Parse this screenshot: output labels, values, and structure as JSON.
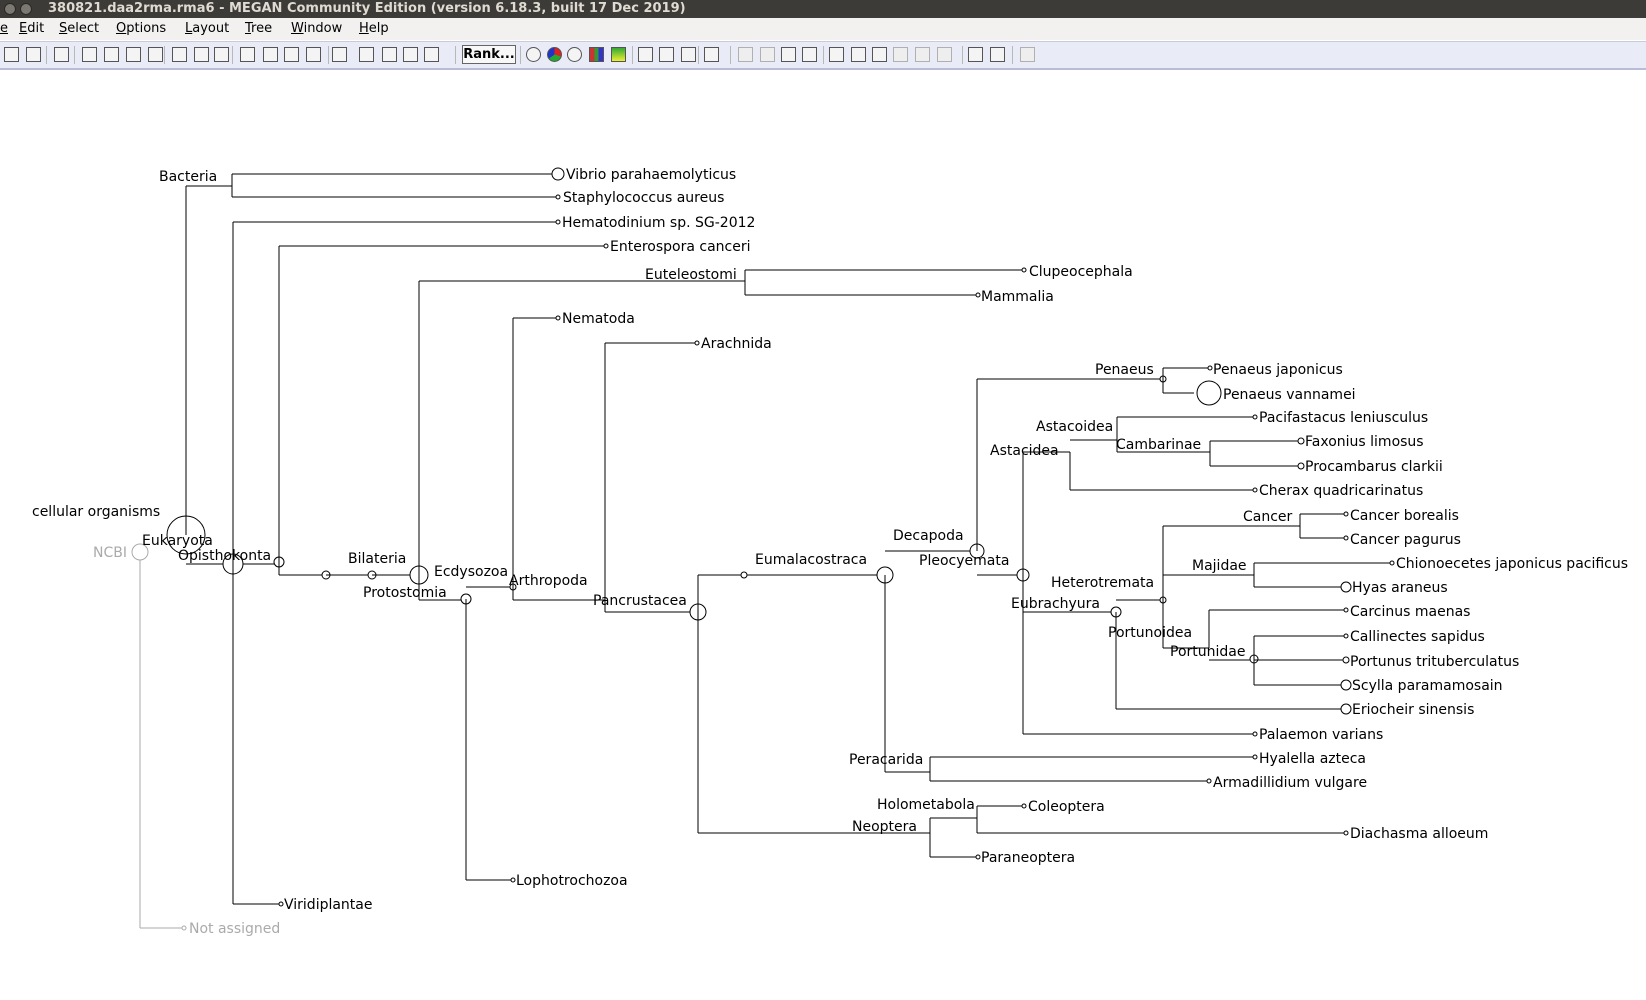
{
  "window": {
    "title": "380821.daa2rma.rma6 - MEGAN Community Edition (version 6.18.3, built 17 Dec 2019)"
  },
  "menu": [
    "e",
    "Edit",
    "Select",
    "Options",
    "Layout",
    "Tree",
    "Window",
    "Help"
  ],
  "toolbar": {
    "buttons": [
      "print-icon",
      "export-icon",
      "find-icon",
      "expand-vertical-icon",
      "contract-vertical-icon",
      "expand-horizontal-icon",
      "contract-horizontal-icon",
      "fit-tree-icon",
      "zoom-width-icon",
      "zoom-full-icon",
      "rooted-tree-icon",
      "cladogram-icon",
      "phylogram-icon",
      "radial-tree-icon",
      "heatmap-icon",
      "collapse-icon",
      "uncollapse-icon",
      "collapse-complement-icon",
      "keep-only-icon",
      "circle-node-icon",
      "pie-chart-icon",
      "coxcomb-icon",
      "bar-chart-icon",
      "heatmap-node-icon",
      "linear-scale-icon",
      "sqrt-scale-icon",
      "log-scale-icon",
      "chart-icon",
      "spacer-icon",
      "spacer-icon-2",
      "show-labels-icon",
      "color-icon",
      "taxon-names-icon",
      "taxon-ids-icon",
      "taxon-rank-icon",
      "assigned-icon",
      "summed-icon",
      "show-all-icon",
      "fit-icon",
      "table-icon",
      "details-icon"
    ],
    "rank_label": "Rank..."
  },
  "tree": {
    "labels": {
      "ncbi": "NCBI",
      "not_assigned": "Not assigned",
      "cellular": "cellular organisms",
      "bacteria": "Bacteria",
      "vibrio": "Vibrio parahaemolyticus",
      "staph": "Staphylococcus aureus",
      "eukaryota": "Eukaryota",
      "hematodinium": "Hematodinium sp. SG-2012",
      "opisthokonta": "Opisthokonta",
      "enterospora": "Enterospora canceri",
      "viridiplantae": "Viridiplantae",
      "bilateria": "Bilateria",
      "euteleostomi": "Euteleostomi",
      "clupeocephala": "Clupeocephala",
      "mammalia": "Mammalia",
      "protostomia": "Protostomia",
      "ecdysozoa": "Ecdysozoa",
      "nematoda": "Nematoda",
      "lophotrochozoa": "Lophotrochozoa",
      "arthropoda": "Arthropoda",
      "arachnida": "Arachnida",
      "pancrustacea": "Pancrustacea",
      "eumalacostraca": "Eumalacostraca",
      "decapoda": "Decapoda",
      "pleocyemata": "Pleocyemata",
      "penaeus": "Penaeus",
      "p_japonicus": "Penaeus japonicus",
      "p_vannamei": "Penaeus vannamei",
      "astacidea": "Astacidea",
      "astacoidea": "Astacoidea",
      "pacifastacus": "Pacifastacus leniusculus",
      "cambarinae": "Cambarinae",
      "faxonius": "Faxonius limosus",
      "procambarus": "Procambarus clarkii",
      "cherax": "Cherax quadricarinatus",
      "eubrachyura": "Eubrachyura",
      "heterotremata": "Heterotremata",
      "cancer": "Cancer",
      "c_borealis": "Cancer borealis",
      "c_pagurus": "Cancer pagurus",
      "majidae": "Majidae",
      "chionoecetes": "Chionoecetes japonicus pacificus",
      "hyas": "Hyas araneus",
      "portunoidea": "Portunoidea",
      "carcinus": "Carcinus maenas",
      "portunidae": "Portunidae",
      "callinectes": "Callinectes sapidus",
      "portunus": "Portunus trituberculatus",
      "scylla": "Scylla paramamosain",
      "eriocheir": "Eriocheir sinensis",
      "palaemon": "Palaemon varians",
      "peracarida": "Peracarida",
      "hyalella": "Hyalella azteca",
      "armadillidium": "Armadillidium vulgare",
      "neoptera": "Neoptera",
      "holometabola": "Holometabola",
      "coleoptera": "Coleoptera",
      "diachasma": "Diachasma alloeum",
      "paraneoptera": "Paraneoptera"
    }
  }
}
